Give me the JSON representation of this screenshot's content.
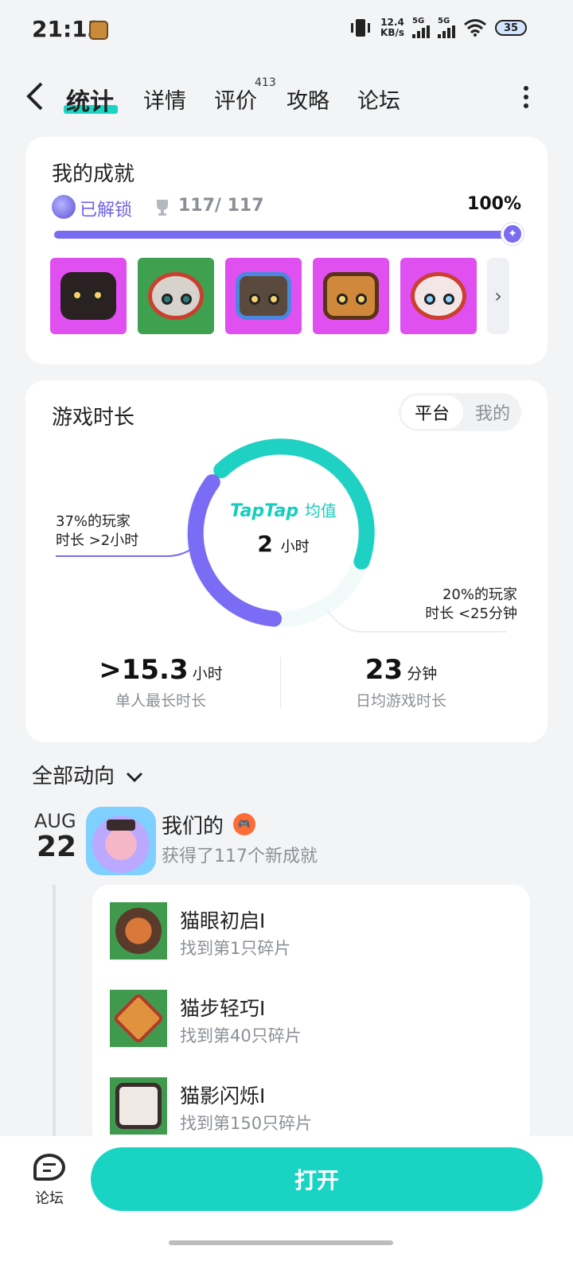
{
  "status_bar": {
    "time": "21:13",
    "net_speed_value": "12.4",
    "net_speed_unit": "KB/s",
    "signal1": "5G",
    "signal2": "5G",
    "battery": "35"
  },
  "nav": {
    "tabs": [
      "统计",
      "详情",
      "评价",
      "攻略",
      "论坛"
    ],
    "active_tab": "统计",
    "review_count": "413"
  },
  "achievements": {
    "title": "我的成就",
    "unlocked_label": "已解锁",
    "progress_text": "117/ 117",
    "progress_pct_text": "100%",
    "progress_fraction": 1.0,
    "badge_colors": [
      "#e04ff0",
      "#3fa04f",
      "#e04ff0",
      "#e04ff0",
      "#e04ff0"
    ]
  },
  "playtime": {
    "title": "游戏时长",
    "toggle": [
      "平台",
      "我的"
    ],
    "toggle_selected": "平台",
    "brand": "TapTap",
    "brand_suffix": "均值",
    "avg_value": "2",
    "avg_unit": "小时",
    "left_annotation": [
      "37%的玩家",
      "时长 >2小时"
    ],
    "right_annotation": [
      "20%的玩家",
      "时长 <25分钟"
    ],
    "ring_colors": {
      "over": "#7b6cf5",
      "under": "#1fd1c2"
    },
    "stats": [
      {
        "value": ">15.3",
        "unit": "小时",
        "label": "单人最长时长"
      },
      {
        "value": "23",
        "unit": "分钟",
        "label": "日均游戏时长"
      }
    ]
  },
  "activity": {
    "filter_label": "全部动向",
    "date_month": "AUG",
    "date_day": "22",
    "name": "我们的",
    "description": "获得了117个新成就",
    "items": [
      {
        "title": "猫眼初启I",
        "desc": "找到第1只碎片"
      },
      {
        "title": "猫步轻巧I",
        "desc": "找到第40只碎片"
      },
      {
        "title": "猫影闪烁I",
        "desc": "找到第150只碎片"
      }
    ]
  },
  "bottom_bar": {
    "forum_label": "论坛",
    "open_label": "打开"
  },
  "colors": {
    "accent": "#19d4c3",
    "purple": "#7a6cf0",
    "background": "#f3f4f6"
  }
}
